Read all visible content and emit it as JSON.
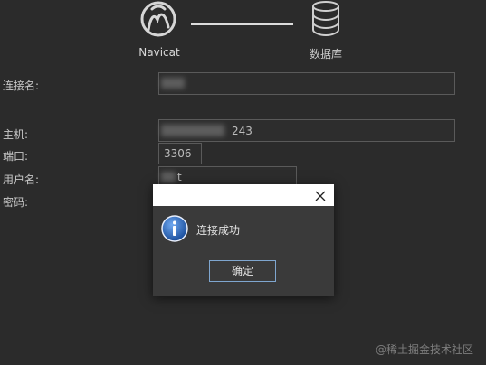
{
  "header": {
    "left_label": "Navicat",
    "right_label": "数据库",
    "left_icon": "navicat-logo-icon",
    "right_icon": "database-icon"
  },
  "form": {
    "connection_name_label": "连接名:",
    "connection_name_value": "",
    "host_label": "主机:",
    "host_value": "243",
    "port_label": "端口:",
    "port_value": "3306",
    "username_label": "用户名:",
    "username_value": "t",
    "password_label": "密码:"
  },
  "dialog": {
    "message": "连接成功",
    "ok_label": "确定",
    "info_icon": "info-icon",
    "close_icon": "close-icon"
  },
  "watermark": "@稀土掘金技术社区",
  "colors": {
    "background": "#2b2b2b",
    "dialog_bg": "#3a3a3a",
    "ok_border": "#7fa6cf",
    "info_blue": "#1f5fb4"
  }
}
